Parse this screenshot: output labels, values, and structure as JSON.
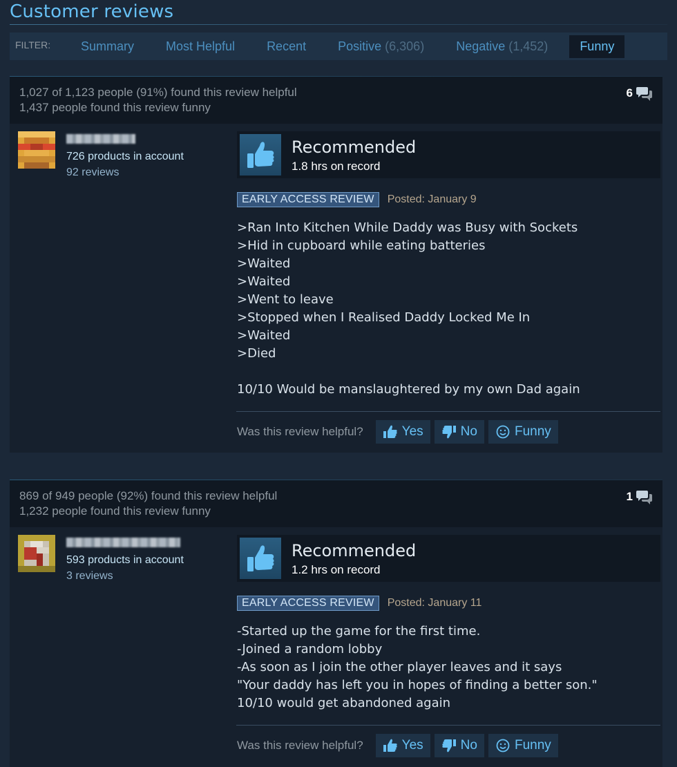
{
  "page_title": "Customer reviews",
  "filter": {
    "label": "FILTER:",
    "tabs": [
      {
        "label": "Summary",
        "count": ""
      },
      {
        "label": "Most Helpful",
        "count": ""
      },
      {
        "label": "Recent",
        "count": ""
      },
      {
        "label": "Positive",
        "count": "(6,306)"
      },
      {
        "label": "Negative",
        "count": "(1,452)"
      },
      {
        "label": "Funny",
        "count": "",
        "active": true
      }
    ]
  },
  "colors": {
    "background": "#1b2838",
    "accent": "#66c0f4",
    "panel": "#16202d",
    "header_bar": "#101822"
  },
  "reviews": [
    {
      "helpful_text": "1,027 of 1,123 people (91%) found this review helpful",
      "funny_text": "1,437 people found this review funny",
      "comment_count": "6",
      "author": {
        "products": "726 products in account",
        "reviews": "92 reviews",
        "avatar_icon": "pixelated-avatar-icon"
      },
      "verdict": "Recommended",
      "hours": "1.8 hrs on record",
      "badge": "EARLY ACCESS REVIEW",
      "posted": "Posted: January 9",
      "text": ">Ran Into Kitchen While Daddy was Busy with Sockets\n>Hid in cupboard while eating batteries\n>Waited\n>Waited\n>Went to leave\n>Stopped when I Realised Daddy Locked Me In\n>Waited\n>Died\n\n10/10 Would be manslaughtered by my own Dad again",
      "helpful_question": "Was this review helpful?",
      "buttons": {
        "yes": "Yes",
        "no": "No",
        "funny": "Funny"
      }
    },
    {
      "helpful_text": "869 of 949 people (92%) found this review helpful",
      "funny_text": "1,232 people found this review funny",
      "comment_count": "1",
      "author": {
        "products": "593 products in account",
        "reviews": "3 reviews",
        "avatar_icon": "pixelated-avatar-icon"
      },
      "verdict": "Recommended",
      "hours": "1.2 hrs on record",
      "badge": "EARLY ACCESS REVIEW",
      "posted": "Posted: January 11",
      "text": "-Started up the game for the first time.\n-Joined a random lobby\n-As soon as I join the other player leaves and it says\n\"Your daddy has left you in hopes of finding a better son.\"\n10/10 would get abandoned again",
      "helpful_question": "Was this review helpful?",
      "buttons": {
        "yes": "Yes",
        "no": "No",
        "funny": "Funny"
      }
    }
  ]
}
